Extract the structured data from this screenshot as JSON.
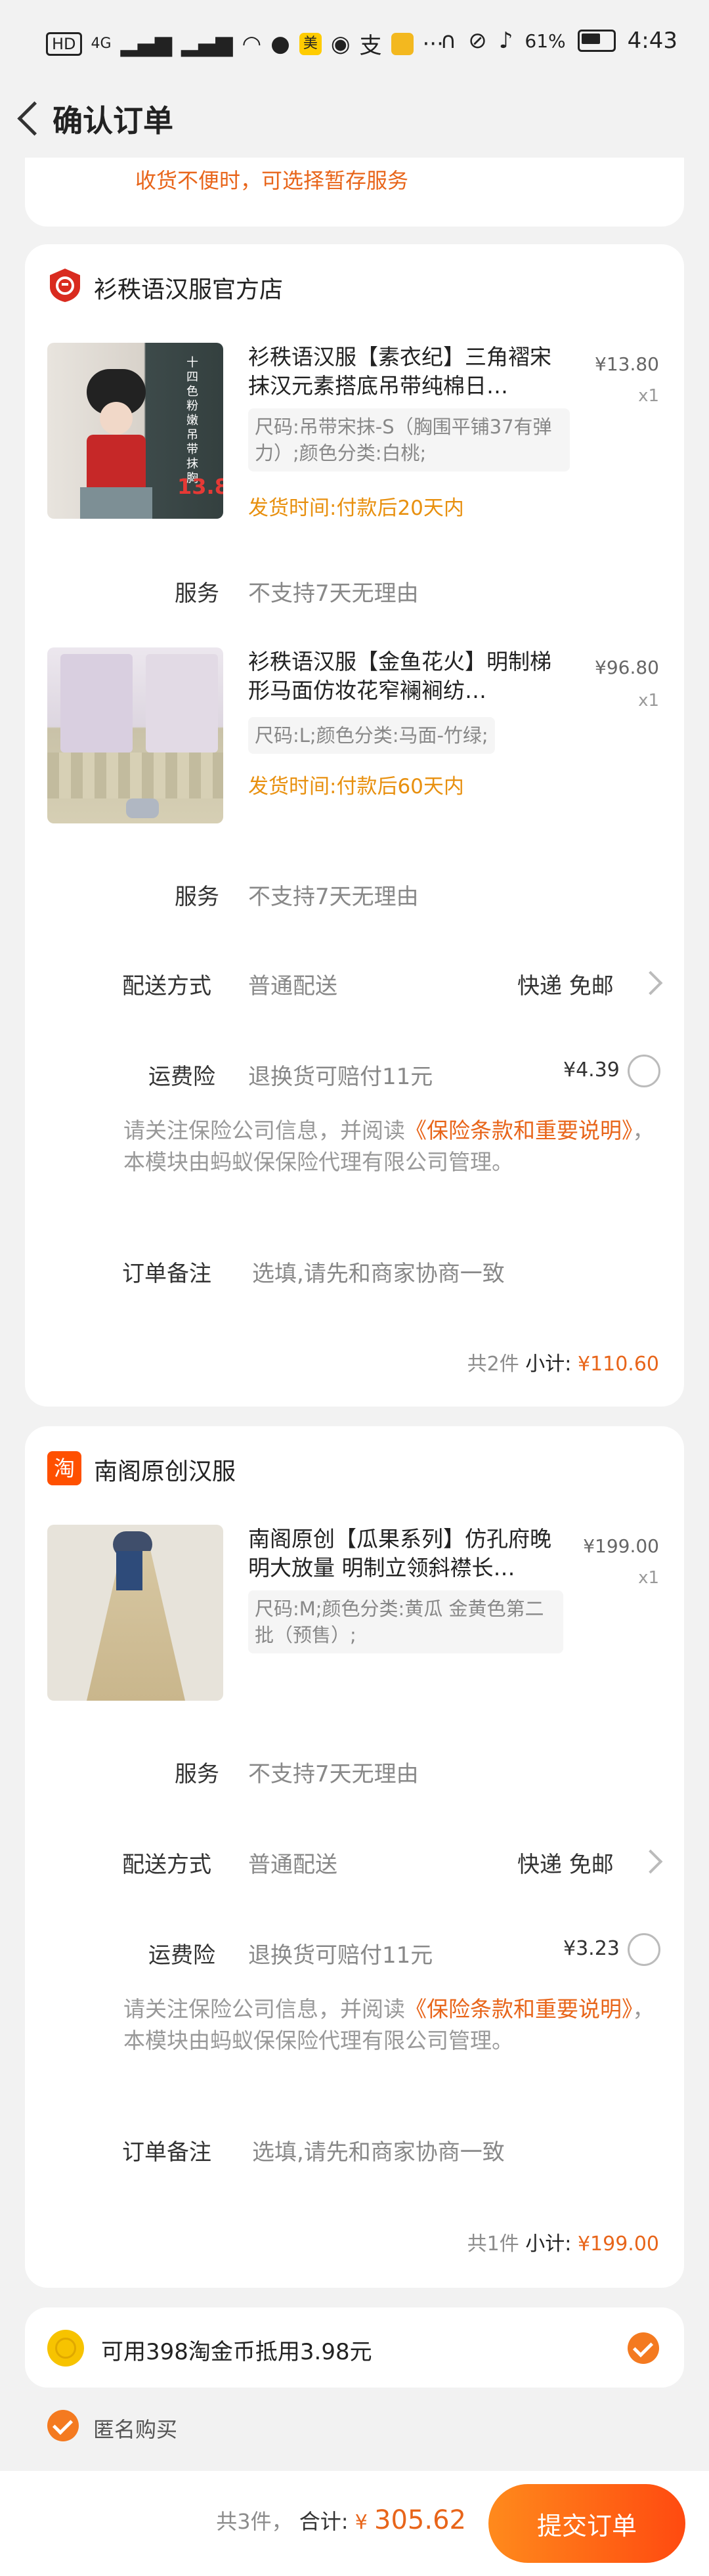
{
  "status_bar": {
    "left_icons": [
      "HD",
      "4G",
      "signal",
      "x-signal",
      "wifi",
      "message",
      "美",
      "bulb",
      "支",
      "notes",
      "···"
    ],
    "battery": "61%",
    "time": "4:43"
  },
  "header": {
    "title": "确认订单"
  },
  "top_notice": "收货不便时，可选择暂存服务",
  "shop1": {
    "name": "衫秩语汉服官方店",
    "items": [
      {
        "title": "衫秩语汉服【素衣纪】三角褶宋抹汉元素搭底吊带纯棉日…",
        "spec": "尺码:吊带宋抹-S（胸围平铺37有弹力）;颜色分类:白桃;",
        "ship": "发货时间:付款后20天内",
        "price": "¥13.80",
        "qty": "x1",
        "service_label": "服务",
        "service_value": "不支持7天无理由",
        "img_text": "十四色粉嫩吊带抹胸",
        "img_price": "13.8"
      },
      {
        "title": "衫秩语汉服【金鱼花火】明制梯形马面仿妆花窄襕裥纺…",
        "spec": "尺码:L;颜色分类:马面-竹绿;",
        "ship": "发货时间:付款后60天内",
        "price": "¥96.80",
        "qty": "x1",
        "service_label": "服务",
        "service_value": "不支持7天无理由"
      }
    ],
    "delivery": {
      "label": "配送方式",
      "value": "普通配送",
      "right": "快递 免邮"
    },
    "insurance": {
      "label": "运费险",
      "value": "退换货可赔付11元",
      "price": "¥4.39"
    },
    "notice_pre": "请关注保险公司信息，并阅读",
    "notice_link": "《保险条款和重要说明》",
    "notice_post": "，本模块由蚂蚁保保险代理有限公司管理。",
    "remark": {
      "label": "订单备注",
      "placeholder": "选填,请先和商家协商一致"
    },
    "subtotal_count": "共2件",
    "subtotal_label": "小计:",
    "subtotal_value": "¥110.60"
  },
  "shop2": {
    "name": "南阁原创汉服",
    "item": {
      "title": "南阁原创【瓜果系列】仿孔府晚明大放量 明制立领斜襟长…",
      "spec": "尺码:M;颜色分类:黄瓜 金黄色第二批（预售）;",
      "price": "¥199.00",
      "qty": "x1",
      "service_label": "服务",
      "service_value": "不支持7天无理由"
    },
    "delivery": {
      "label": "配送方式",
      "value": "普通配送",
      "right": "快递 免邮"
    },
    "insurance": {
      "label": "运费险",
      "value": "退换货可赔付11元",
      "price": "¥3.23"
    },
    "notice_pre": "请关注保险公司信息，并阅读",
    "notice_link": "《保险条款和重要说明》",
    "notice_post": "，本模块由蚂蚁保保险代理有限公司管理。",
    "remark": {
      "label": "订单备注",
      "placeholder": "选填,请先和商家协商一致"
    },
    "subtotal_count": "共1件",
    "subtotal_label": "小计:",
    "subtotal_value": "¥199.00"
  },
  "coins": {
    "text": "可用398淘金币抵用3.98元",
    "checked": true
  },
  "anonymous": {
    "text": "匿名购买",
    "checked": true
  },
  "footer": {
    "count": "共3件，",
    "total_label": "合计:",
    "total_currency": "¥",
    "total_value": "305.62",
    "submit": "提交订单"
  },
  "colors": {
    "accent": "#ff5000",
    "orange_text": "#e8651a",
    "background": "#f2f2f2"
  }
}
